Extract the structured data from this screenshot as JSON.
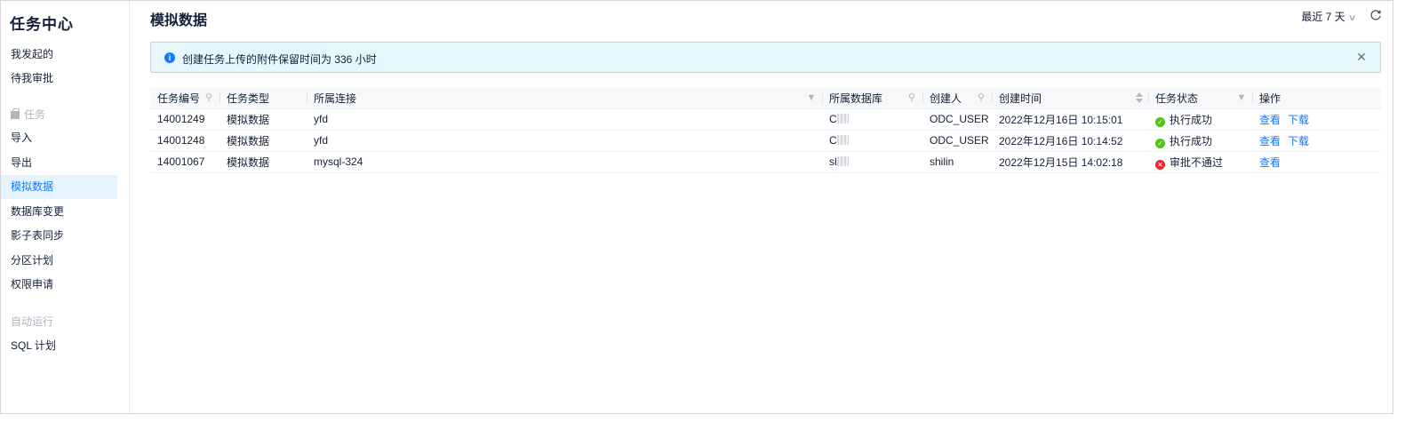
{
  "sidebar": {
    "title": "任务中心",
    "items_top": [
      {
        "label": "我发起的"
      },
      {
        "label": "待我审批"
      }
    ],
    "group_task": "任务",
    "items_task": [
      {
        "label": "导入"
      },
      {
        "label": "导出"
      },
      {
        "label": "模拟数据",
        "active": true
      },
      {
        "label": "数据库变更"
      },
      {
        "label": "影子表同步"
      },
      {
        "label": "分区计划"
      },
      {
        "label": "权限申请"
      }
    ],
    "group_auto": "自动运行",
    "items_auto": [
      {
        "label": "SQL 计划"
      }
    ]
  },
  "header": {
    "title": "模拟数据",
    "date_filter": "最近 7 天"
  },
  "alert": {
    "text": "创建任务上传的附件保留时间为 336 小时"
  },
  "table": {
    "columns": [
      "任务编号",
      "任务类型",
      "所属连接",
      "所属数据库",
      "创建人",
      "创建时间",
      "任务状态",
      "操作"
    ],
    "rows": [
      {
        "id": "14001249",
        "type": "模拟数据",
        "connection": "yfd",
        "database": "C",
        "creator": "ODC_USER",
        "created_at": "2022年12月16日 10:15:01",
        "status": "执行成功",
        "status_kind": "success",
        "actions": [
          "查看",
          "下载"
        ]
      },
      {
        "id": "14001248",
        "type": "模拟数据",
        "connection": "yfd",
        "database": "C",
        "creator": "ODC_USER",
        "created_at": "2022年12月16日 10:14:52",
        "status": "执行成功",
        "status_kind": "success",
        "actions": [
          "查看",
          "下载"
        ]
      },
      {
        "id": "14001067",
        "type": "模拟数据",
        "connection": "mysql-324",
        "database": "sl",
        "creator": "shilin",
        "created_at": "2022年12月15日 14:02:18",
        "status": "审批不通过",
        "status_kind": "fail",
        "actions": [
          "查看"
        ]
      }
    ]
  },
  "colors": {
    "accent": "#1677ff",
    "success": "#52c41a",
    "fail": "#f5222d",
    "alert_bg": "#e6f7fd"
  }
}
